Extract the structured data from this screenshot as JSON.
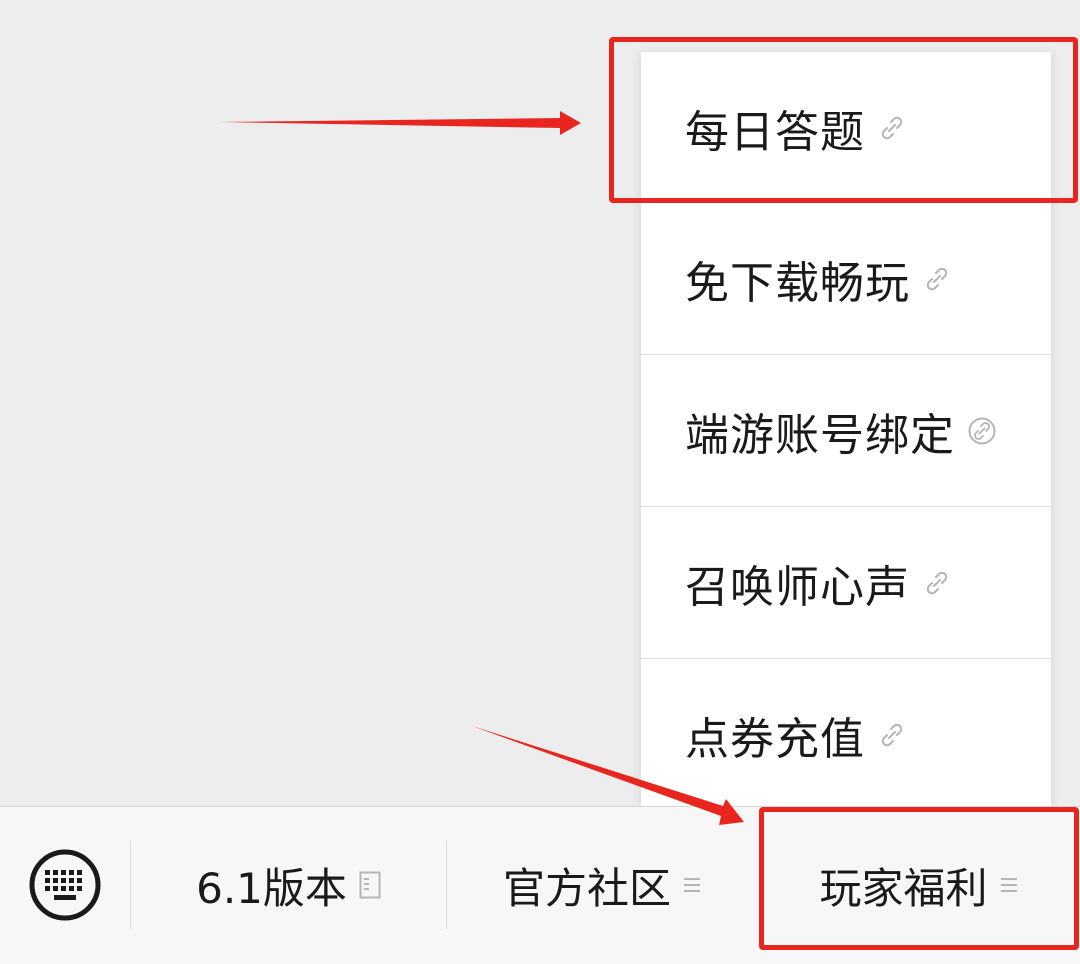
{
  "menu": {
    "items": [
      {
        "label": "每日答题",
        "icon": "mini-program-link-icon"
      },
      {
        "label": "免下载畅玩",
        "icon": "mini-program-link-icon"
      },
      {
        "label": "端游账号绑定",
        "icon": "mini-program-circle-link-icon"
      },
      {
        "label": "召唤师心声",
        "icon": "mini-program-link-icon"
      },
      {
        "label": "点券充值",
        "icon": "mini-program-link-icon"
      }
    ]
  },
  "bottom_bar": {
    "keyboard_icon": "keyboard-icon",
    "tabs": [
      {
        "label": "6.1版本",
        "icon": "article-icon"
      },
      {
        "label": "官方社区",
        "icon": "menu-lines-icon"
      },
      {
        "label": "玩家福利",
        "icon": "menu-lines-icon"
      }
    ]
  },
  "colors": {
    "annotation": "#e8261f",
    "background": "#ededed",
    "menu_background": "#ffffff",
    "text": "#1a1a1a",
    "icon_gray": "#b5b5b5"
  }
}
